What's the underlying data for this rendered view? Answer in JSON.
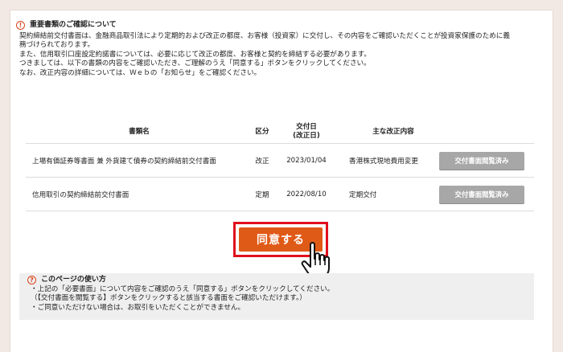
{
  "notice": {
    "icon": "exclamation-icon",
    "title": "重要書類のご確認について",
    "lines": [
      "契約締結前交付書面は、金融商品取引法により定期的および改正の都度、お客様（投資家）に交付し、その内容をご確認いただくことが投資家保護のために義",
      "務づけられております。",
      "また、信用取引口座設定約諾書については、必要に応じて改正の都度、お客様と契約を締結する必要があります。",
      "つきましては、以下の書類の内容をご確認いただき、ご理解のうえ「同意する」ボタンをクリックしてください。",
      "なお、改正内容の詳細については、Ｗｅｂの「お知らせ」をご確認ください。"
    ]
  },
  "table": {
    "headers": {
      "name": "書類名",
      "kubun": "区分",
      "date_line1": "交付日",
      "date_line2": "(改正日)",
      "content": "主な改正内容"
    },
    "rows": [
      {
        "name": "上場有価証券等書面 兼 外貨建て債券の契約締結前交付書面",
        "kubun": "改正",
        "date": "2023/01/04",
        "content": "香港株式現地費用変更",
        "button": "交付書面閲覧済み"
      },
      {
        "name": "信用取引の契約締結前交付書面",
        "kubun": "定期",
        "date": "2022/08/10",
        "content": "定期交付",
        "button": "交付書面閲覧済み"
      }
    ]
  },
  "agree_button": "同意する",
  "cursor_icon": "hand-pointer-icon",
  "howto": {
    "icon": "question-icon",
    "title": "このページの使い方",
    "lines": [
      "・上記の「必要書面」について内容をご確認のうえ「同意する」ボタンをクリックしてください。",
      "（【交付書面を閲覧する】ボタンをクリックすると該当する書面をご確認いただけます。）",
      "・ご同意いただけない場合は、お取引をいただくことができません。"
    ]
  },
  "colors": {
    "accent": "#e05a17",
    "highlight_border": "#e0101e",
    "icon": "#d9461d",
    "view_button": "#a7a7a7"
  }
}
